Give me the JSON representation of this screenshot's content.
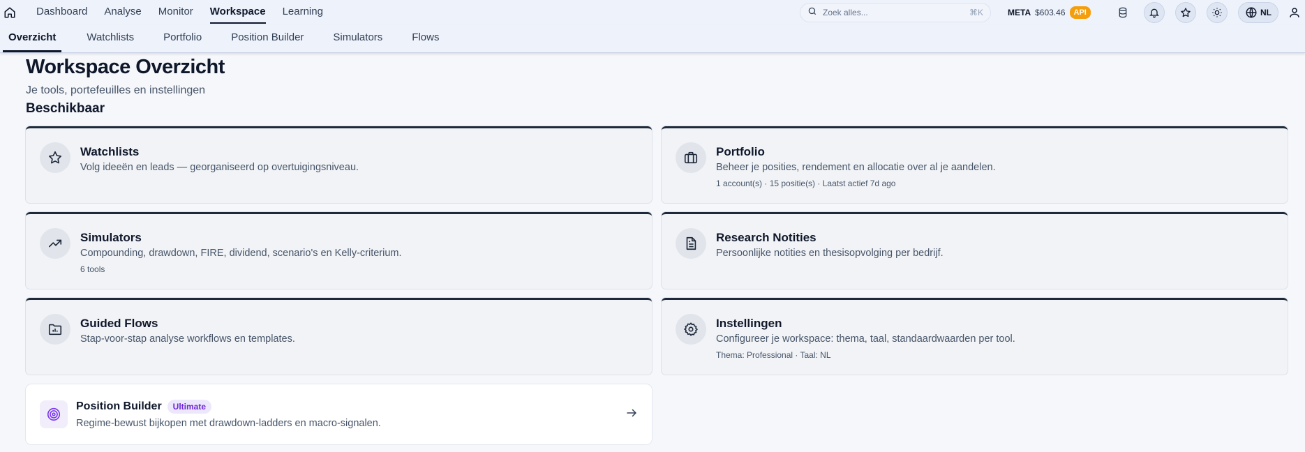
{
  "nav": {
    "items": [
      {
        "label": "Dashboard",
        "active": false
      },
      {
        "label": "Analyse",
        "active": false
      },
      {
        "label": "Monitor",
        "active": false
      },
      {
        "label": "Workspace",
        "active": true
      },
      {
        "label": "Learning",
        "active": false
      }
    ]
  },
  "search": {
    "placeholder": "Zoek alles...",
    "shortcut": "⌘K"
  },
  "ticker": {
    "symbol": "META",
    "price": "$603.46",
    "badge": "API"
  },
  "language": {
    "code": "NL"
  },
  "subnav": {
    "items": [
      {
        "label": "Overzicht",
        "active": true
      },
      {
        "label": "Watchlists",
        "active": false
      },
      {
        "label": "Portfolio",
        "active": false
      },
      {
        "label": "Position Builder",
        "active": false
      },
      {
        "label": "Simulators",
        "active": false
      },
      {
        "label": "Flows",
        "active": false
      }
    ]
  },
  "page": {
    "title": "Workspace Overzicht",
    "subtitle": "Je tools, portefeuilles en instellingen",
    "section": "Beschikbaar"
  },
  "cards": [
    {
      "icon": "star-icon",
      "title": "Watchlists",
      "desc": "Volg ideeën en leads — georganiseerd op overtuigingsniveau.",
      "meta": ""
    },
    {
      "icon": "briefcase-icon",
      "title": "Portfolio",
      "desc": "Beheer je posities, rendement en allocatie over al je aandelen.",
      "meta": "1 account(s) · 15 positie(s) · Laatst actief 7d ago"
    },
    {
      "icon": "trending-up-icon",
      "title": "Simulators",
      "desc": "Compounding, drawdown, FIRE, dividend, scenario's en Kelly-criterium.",
      "meta": "6 tools"
    },
    {
      "icon": "document-icon",
      "title": "Research Notities",
      "desc": "Persoonlijke notities en thesisopvolging per bedrijf.",
      "meta": ""
    },
    {
      "icon": "folder-chart-icon",
      "title": "Guided Flows",
      "desc": "Stap-voor-stap analyse workflows en templates.",
      "meta": ""
    },
    {
      "icon": "gear-icon",
      "title": "Instellingen",
      "desc": "Configureer je workspace: thema, taal, standaardwaarden per tool.",
      "meta": "Thema: Professional · Taal: NL"
    }
  ],
  "position_builder": {
    "title": "Position Builder",
    "tier": "Ultimate",
    "desc": "Regime-bewust bijkopen met drawdown-ladders en macro-signalen."
  },
  "colors": {
    "accent_badge": "#f59e0b",
    "tier_text": "#6d28d9",
    "dark": "#0f172a"
  }
}
